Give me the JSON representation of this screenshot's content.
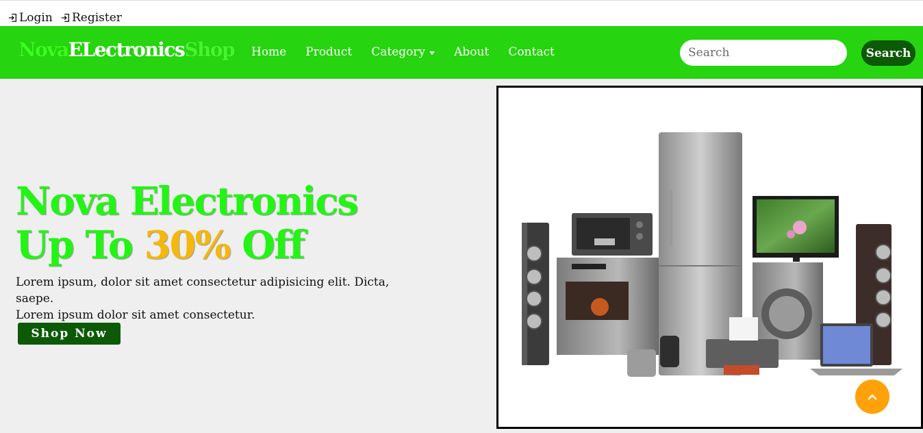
{
  "topbar": {
    "login": "Login",
    "register": "Register"
  },
  "brand": {
    "part1": "Nova",
    "part2": "ELectronics",
    "part3": "Shop"
  },
  "nav": {
    "home": "Home",
    "product": "Product",
    "category": "Category",
    "about": "About",
    "contact": "Contact"
  },
  "search": {
    "placeholder": "Search",
    "button": "Search"
  },
  "hero": {
    "title_line1": "Nova Electronics",
    "title_line2_pre": "Up To ",
    "title_line2_pct": "30%",
    "title_line2_post": " Off",
    "text_line1": "Lorem ipsum, dolor sit amet consectetur adipisicing elit. Dicta, saepe.",
    "text_line2": "Lorem ipsum dolor sit amet consectetur.",
    "button": "Shop Now"
  },
  "colors": {
    "navbar": "#26d40f",
    "accent_dark": "#0c5a06",
    "title_green": "#22f514",
    "title_orange": "#f5b70c",
    "scroll_top": "#ffa10a"
  },
  "icons": {
    "login": "sign-in-icon",
    "register": "sign-in-icon",
    "scroll_top": "chevron-up-icon"
  }
}
